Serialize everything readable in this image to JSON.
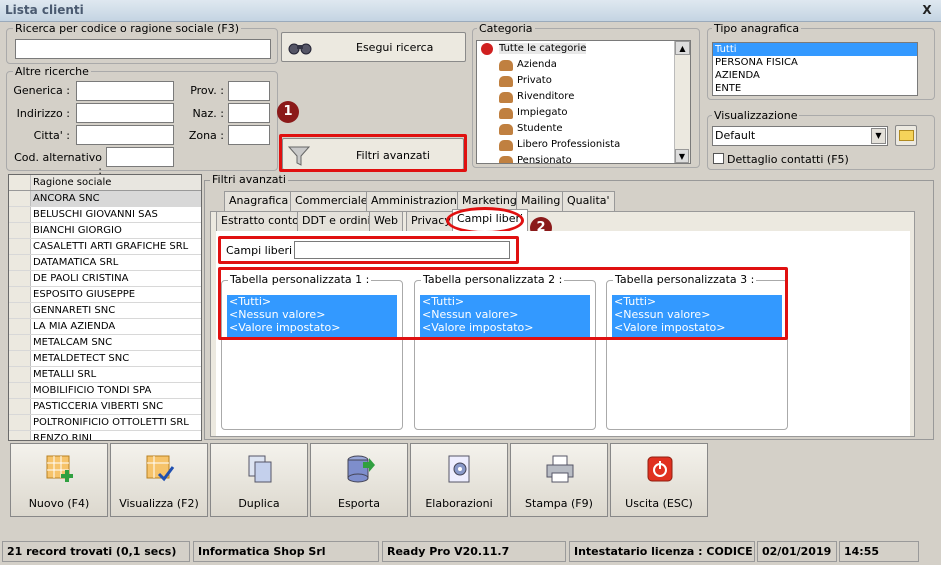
{
  "window": {
    "title": "Lista clienti",
    "close": "X"
  },
  "search": {
    "label": "Ricerca per codice o ragione sociale (F3)",
    "value": "",
    "run_button": "Esegui ricerca"
  },
  "altre": {
    "label": "Altre ricerche",
    "generica": "Generica :",
    "indirizzo": "Indirizzo :",
    "citta": "Citta' :",
    "cod_alt": "Cod. alternativo :",
    "prov": "Prov. :",
    "naz": "Naz. :",
    "zona": "Zona :"
  },
  "filtri_button": "Filtri avanzati",
  "categoria": {
    "label": "Categoria",
    "items": [
      "Tutte le categorie",
      "Azienda",
      "Privato",
      "Rivenditore",
      "Impiegato",
      "Studente",
      "Libero Professionista",
      "Pensionato"
    ]
  },
  "tipo": {
    "label": "Tipo anagrafica",
    "items": [
      "Tutti",
      "PERSONA FISICA",
      "AZIENDA",
      "ENTE"
    ]
  },
  "visualizzazione": {
    "label": "Visualizzazione",
    "value": "Default",
    "dettaglio": "Dettaglio contatti (F5)"
  },
  "grid": {
    "header": "Ragione sociale",
    "rows": [
      "ANCORA SNC",
      "BELUSCHI GIOVANNI SAS",
      "BIANCHI GIORGIO",
      "CASALETTI ARTI GRAFICHE SRL",
      "DATAMATICA SRL",
      "DE PAOLI CRISTINA",
      "ESPOSITO GIUSEPPE",
      "GENNARETI SNC",
      "LA MIA AZIENDA",
      "METALCAM SNC",
      "METALDETECT SNC",
      "METALLI SRL",
      "MOBILIFICIO TONDI SPA",
      "PASTICCERIA VIBERTI SNC",
      "POLTRONIFICIO OTTOLETTI SRL",
      "RENZO RINI"
    ]
  },
  "panel": {
    "label": "Filtri avanzati",
    "tabs_row1": [
      "Anagrafica",
      "Commerciale",
      "Amministrazione",
      "Marketing",
      "Mailing",
      "Qualita'"
    ],
    "tabs_row2": [
      "Estratto conto",
      "DDT e ordini",
      "Web",
      "Privacy",
      "Campi liberi"
    ],
    "campi_liberi_label": "Campi liberi :",
    "tabelle": [
      {
        "label": "Tabella personalizzata 1 :"
      },
      {
        "label": "Tabella personalizzata 2 :"
      },
      {
        "label": "Tabella personalizzata 3 :"
      }
    ],
    "tab_items": [
      "<Tutti>",
      "<Nessun valore>",
      "<Valore impostato>"
    ]
  },
  "badges": [
    "1",
    "2"
  ],
  "toolbar": [
    "Nuovo (F4)",
    "Visualizza (F2)",
    "Duplica",
    "Esporta",
    "Elaborazioni",
    "Stampa (F9)",
    "Uscita (ESC)"
  ],
  "status": {
    "records": "21 record trovati (0,1 secs)",
    "company": "Informatica Shop Srl",
    "version": "Ready Pro V20.11.7",
    "license": "Intestatario licenza : CODICE SRL",
    "date": "02/01/2019",
    "time": "14:55"
  }
}
